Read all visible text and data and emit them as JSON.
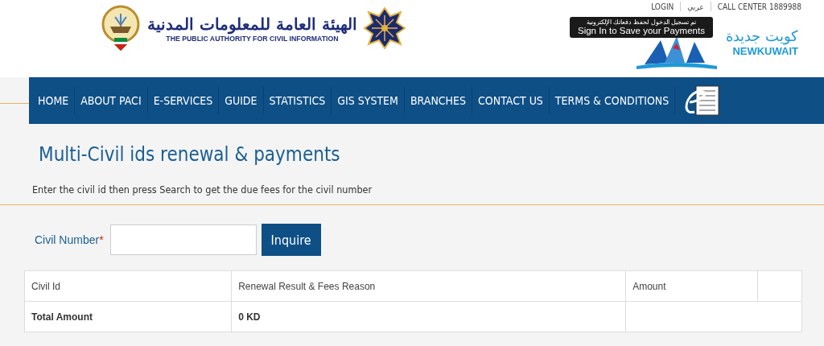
{
  "header": {
    "org_name_arabic": "الهيئة العامة للمعلومات المدنية",
    "org_name": "THE PUBLIC AUTHORITY FOR CIVIL INFORMATION",
    "top_links": [
      "LOGIN",
      "عربي",
      "CALL CENTER 1889988"
    ],
    "tooltip": {
      "arabic": "تم تسجيل الدخول لحفظ دفعاتك الإلكترونية",
      "text": "Sign In to Save your Payments"
    },
    "brand_arabic": "كويت جديدة",
    "brand": "NEWKUWAIT"
  },
  "nav": {
    "items": [
      "HOME",
      "ABOUT PACI",
      "E-SERVICES",
      "GUIDE",
      "STATISTICS",
      "GIS SYSTEM",
      "BRANCHES",
      "CONTACT US",
      "TERMS & CONDITIONS"
    ]
  },
  "page": {
    "title": "Multi-Civil ids renewal & payments",
    "instructions": "Enter the civil id then press Search to get the due fees for the civil number"
  },
  "form": {
    "label": "Civil Number",
    "required_mark": "*",
    "button": "Inquire"
  },
  "table": {
    "columns": [
      "Civil Id",
      "Renewal Result & Fees Reason",
      "Amount"
    ],
    "total": {
      "label": "Total Amount",
      "value": "0 KD"
    }
  }
}
